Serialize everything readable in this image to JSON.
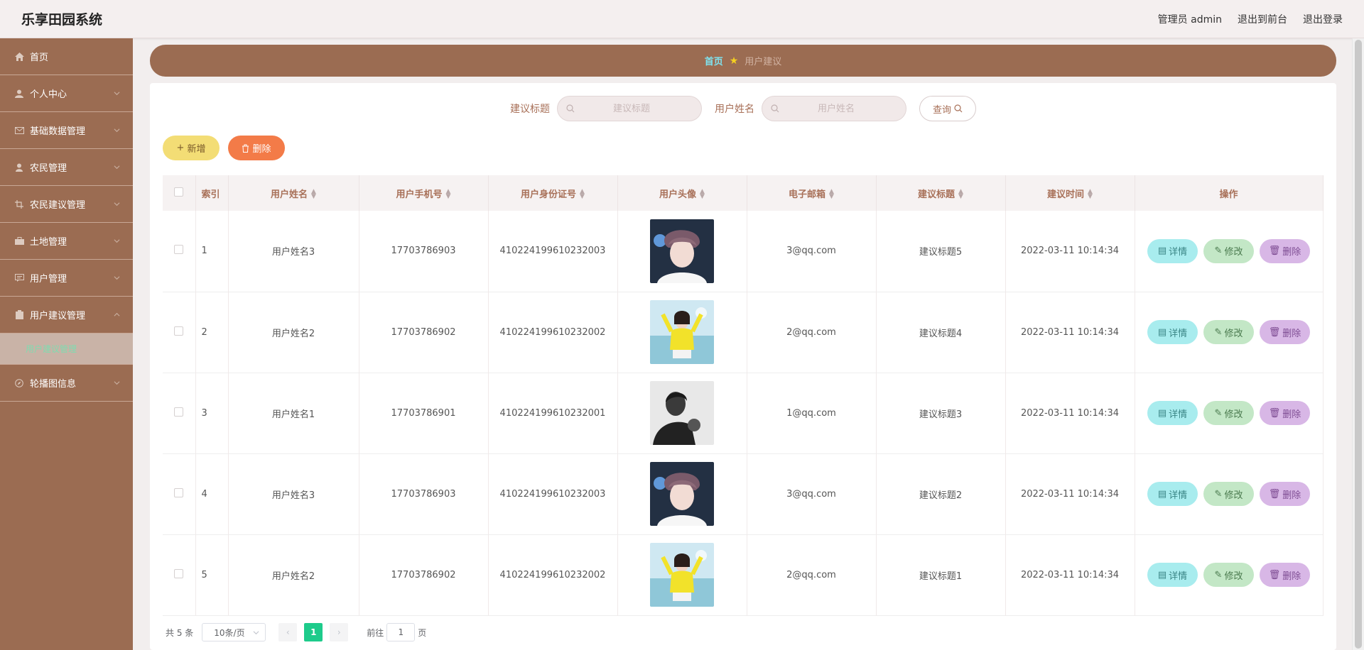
{
  "app": {
    "title": "乐享田园系统"
  },
  "topbar": {
    "user": "管理员 admin",
    "front": "退出到前台",
    "logout": "退出登录"
  },
  "sidebar": {
    "items": [
      {
        "label": "首页",
        "icon": "home-icon"
      },
      {
        "label": "个人中心",
        "icon": "user-icon"
      },
      {
        "label": "基础数据管理",
        "icon": "mail-icon"
      },
      {
        "label": "农民管理",
        "icon": "person-icon"
      },
      {
        "label": "农民建议管理",
        "icon": "crop-icon"
      },
      {
        "label": "土地管理",
        "icon": "suitcase-icon"
      },
      {
        "label": "用户管理",
        "icon": "chat-icon"
      },
      {
        "label": "用户建议管理",
        "icon": "clipboard-icon"
      },
      {
        "label": "轮播图信息",
        "icon": "compass-icon"
      }
    ],
    "submenu": {
      "label": "用户建议管理"
    }
  },
  "breadcrumb": {
    "home": "首页",
    "current": "用户建议"
  },
  "search": {
    "title_label": "建议标题",
    "title_placeholder": "建议标题",
    "name_label": "用户姓名",
    "name_placeholder": "用户姓名",
    "query": "查询"
  },
  "actions": {
    "add": "新增",
    "delete": "删除"
  },
  "table": {
    "columns": [
      "索引",
      "用户姓名",
      "用户手机号",
      "用户身份证号",
      "用户头像",
      "电子邮箱",
      "建议标题",
      "建议时间",
      "操作"
    ],
    "rows": [
      {
        "index": "1",
        "name": "用户姓名3",
        "phone": "17703786903",
        "idcard": "410224199610232003",
        "email": "3@qq.com",
        "title": "建议标题5",
        "time": "2022-03-11 10:14:34",
        "avatar": "boy"
      },
      {
        "index": "2",
        "name": "用户姓名2",
        "phone": "17703786902",
        "idcard": "410224199610232002",
        "email": "2@qq.com",
        "title": "建议标题4",
        "time": "2022-03-11 10:14:34",
        "avatar": "girl"
      },
      {
        "index": "3",
        "name": "用户姓名1",
        "phone": "17703786901",
        "idcard": "410224199610232001",
        "email": "1@qq.com",
        "title": "建议标题3",
        "time": "2022-03-11 10:14:34",
        "avatar": "bw"
      },
      {
        "index": "4",
        "name": "用户姓名3",
        "phone": "17703786903",
        "idcard": "410224199610232003",
        "email": "3@qq.com",
        "title": "建议标题2",
        "time": "2022-03-11 10:14:34",
        "avatar": "boy"
      },
      {
        "index": "5",
        "name": "用户姓名2",
        "phone": "17703786902",
        "idcard": "410224199610232002",
        "email": "2@qq.com",
        "title": "建议标题1",
        "time": "2022-03-11 10:14:34",
        "avatar": "girl"
      }
    ],
    "ops": {
      "detail": "详情",
      "edit": "修改",
      "delete": "删除"
    }
  },
  "pager": {
    "total": "共 5 条",
    "page_size": "10条/页",
    "current": "1",
    "goto_prefix": "前往",
    "goto_value": "1",
    "goto_suffix": "页"
  },
  "colors": {
    "brand": "#9b6c52",
    "accent": "#1ecb8b",
    "add": "#f3dd75",
    "delete": "#f37b48"
  }
}
